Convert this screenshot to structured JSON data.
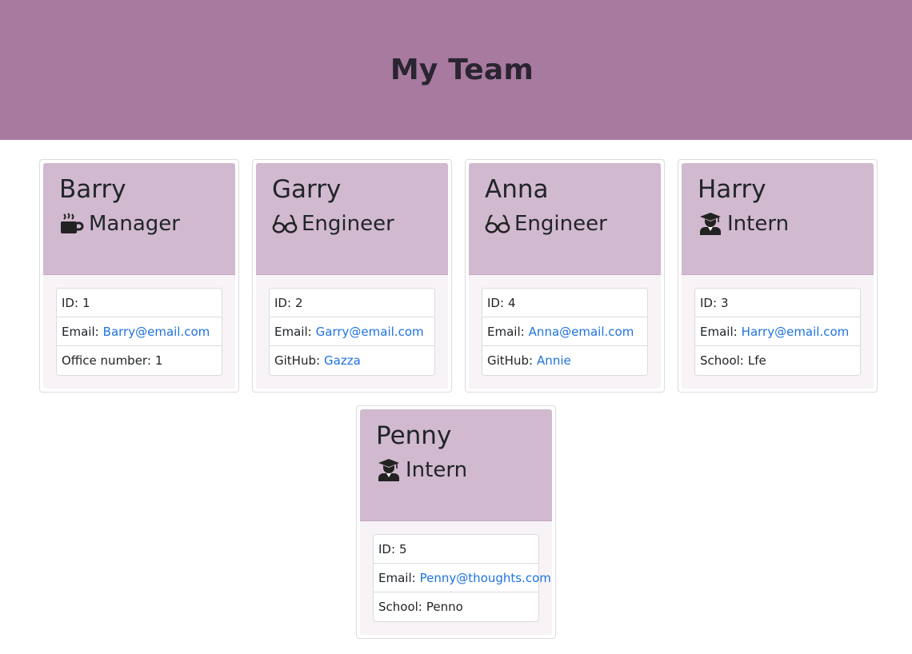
{
  "header": {
    "title": "My Team"
  },
  "cards": [
    {
      "name": "Barry",
      "role": "Manager",
      "role_icon": "coffee-icon",
      "rows": [
        {
          "label": "ID:",
          "value": "1"
        },
        {
          "label": "Email:",
          "value": "Barry@email.com"
        },
        {
          "label": "Office number:",
          "value": "1"
        }
      ]
    },
    {
      "name": "Garry",
      "role": "Engineer",
      "role_icon": "glasses-icon",
      "rows": [
        {
          "label": "ID:",
          "value": "2"
        },
        {
          "label": "Email:",
          "value": "Garry@email.com"
        },
        {
          "label": "GitHub:",
          "value": "Gazza"
        }
      ]
    },
    {
      "name": "Anna",
      "role": "Engineer",
      "role_icon": "glasses-icon",
      "rows": [
        {
          "label": "ID:",
          "value": "4"
        },
        {
          "label": "Email:",
          "value": "Anna@email.com"
        },
        {
          "label": "GitHub:",
          "value": "Annie"
        }
      ]
    },
    {
      "name": "Harry",
      "role": "Intern",
      "role_icon": "graduate-icon",
      "rows": [
        {
          "label": "ID:",
          "value": "3"
        },
        {
          "label": "Email:",
          "value": "Harry@email.com"
        },
        {
          "label": "School:",
          "value": "Lfe"
        }
      ]
    },
    {
      "name": "Penny",
      "role": "Intern",
      "role_icon": "graduate-icon",
      "rows": [
        {
          "label": "ID:",
          "value": "5"
        },
        {
          "label": "Email:",
          "value": "Penny@thoughts.com"
        },
        {
          "label": "School:",
          "value": "Penno"
        }
      ]
    }
  ],
  "colors": {
    "header_bg": "#a87aa0",
    "card_head_bg": "#d1b9cf",
    "link": "#1e73e0"
  }
}
